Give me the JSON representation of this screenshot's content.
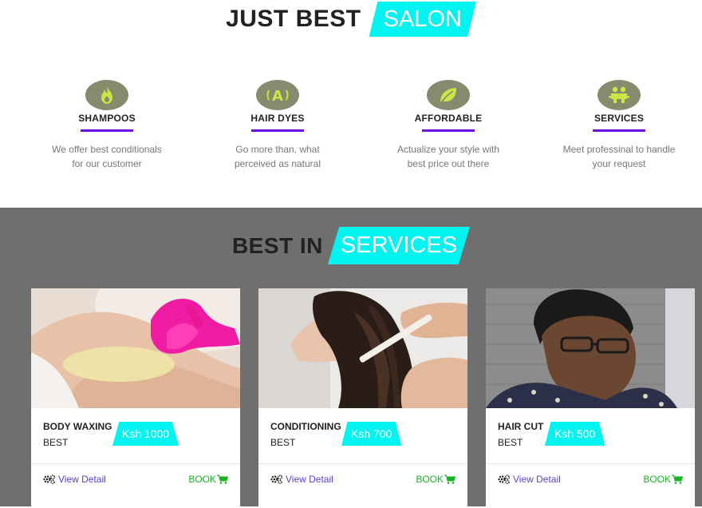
{
  "hero": {
    "title_dark": "JUST BEST",
    "title_tag": "SALON"
  },
  "features": [
    {
      "icon": "flame-icon",
      "title": "SHAMPOOS",
      "text_line1": "We offer best conditionals",
      "text_line2": "for our customer"
    },
    {
      "icon": "font-icon",
      "title": "HAIR DYES",
      "text_line1": "Go more than, what",
      "text_line2": "perceived as natural"
    },
    {
      "icon": "leaf-icon",
      "title": "AFFORDABLE",
      "text_line1": "Actualize your style with",
      "text_line2": "best price out there"
    },
    {
      "icon": "users-icon",
      "title": "SERVICES",
      "text_line1": "Meet professinal to handle",
      "text_line2": "your request"
    }
  ],
  "services": {
    "title_dark": "BEST IN",
    "title_tag": "SERVICES",
    "cards": [
      {
        "name": "BODY WAXING",
        "sub": "BEST",
        "price": "Ksh 1000",
        "view": "View Detail",
        "book": "BOOK"
      },
      {
        "name": "CONDITIONING",
        "sub": "BEST",
        "price": "Ksh 700",
        "view": "View Detail",
        "book": "BOOK"
      },
      {
        "name": "HAIR CUT",
        "sub": "BEST",
        "price": "Ksh 500",
        "view": "View Detail",
        "book": "BOOK"
      }
    ]
  },
  "colors": {
    "accent": "#00f5f0",
    "underline": "#6c12e0",
    "icon_bg": "#878a6c",
    "icon_fg": "#c8e645",
    "services_bg": "#6f6f6f",
    "link": "#5a3fd6",
    "book": "#19b423"
  }
}
